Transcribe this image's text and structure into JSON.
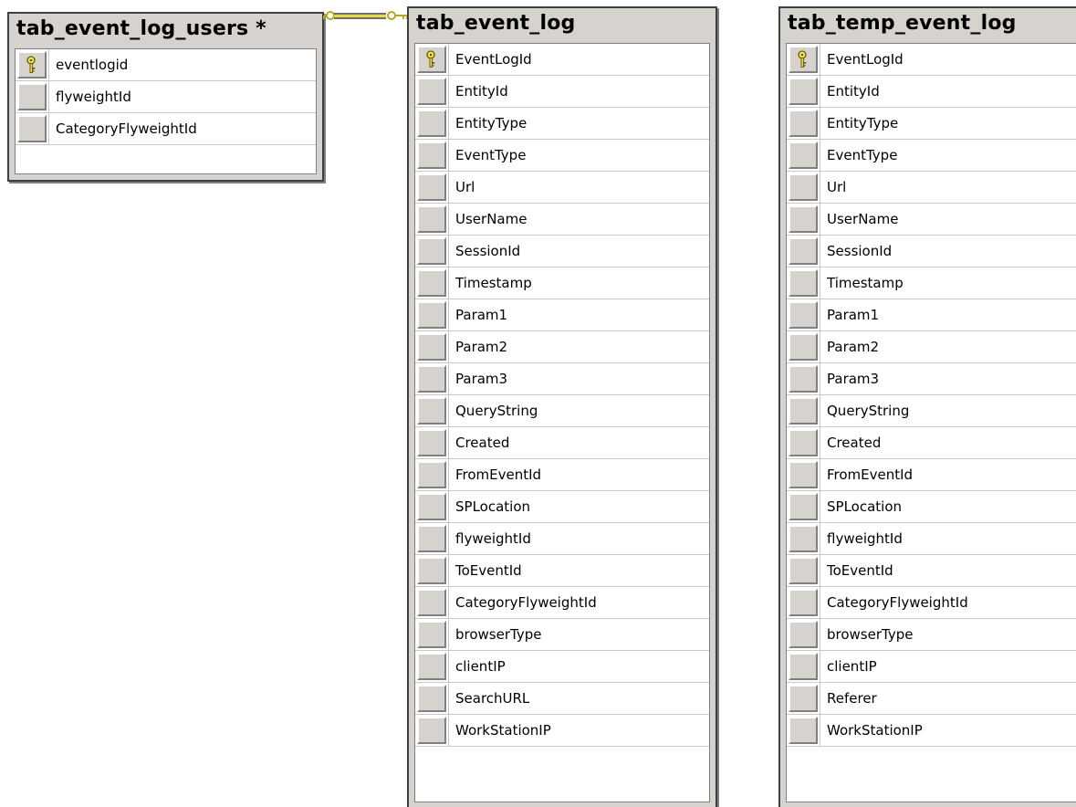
{
  "tables": [
    {
      "title": "tab_event_log_users *",
      "columns": [
        {
          "name": "eventlogid",
          "primary_key": true
        },
        {
          "name": "flyweightId",
          "primary_key": false
        },
        {
          "name": "CategoryFlyweightId",
          "primary_key": false
        }
      ]
    },
    {
      "title": "tab_event_log",
      "columns": [
        {
          "name": "EventLogId",
          "primary_key": true
        },
        {
          "name": "EntityId",
          "primary_key": false
        },
        {
          "name": "EntityType",
          "primary_key": false
        },
        {
          "name": "EventType",
          "primary_key": false
        },
        {
          "name": "Url",
          "primary_key": false
        },
        {
          "name": "UserName",
          "primary_key": false
        },
        {
          "name": "SessionId",
          "primary_key": false
        },
        {
          "name": "Timestamp",
          "primary_key": false
        },
        {
          "name": "Param1",
          "primary_key": false
        },
        {
          "name": "Param2",
          "primary_key": false
        },
        {
          "name": "Param3",
          "primary_key": false
        },
        {
          "name": "QueryString",
          "primary_key": false
        },
        {
          "name": "Created",
          "primary_key": false
        },
        {
          "name": "FromEventId",
          "primary_key": false
        },
        {
          "name": "SPLocation",
          "primary_key": false
        },
        {
          "name": "flyweightId",
          "primary_key": false
        },
        {
          "name": "ToEventId",
          "primary_key": false
        },
        {
          "name": "CategoryFlyweightId",
          "primary_key": false
        },
        {
          "name": "browserType",
          "primary_key": false
        },
        {
          "name": "clientIP",
          "primary_key": false
        },
        {
          "name": "SearchURL",
          "primary_key": false
        },
        {
          "name": "WorkStationIP",
          "primary_key": false
        }
      ]
    },
    {
      "title": "tab_temp_event_log",
      "columns": [
        {
          "name": "EventLogId",
          "primary_key": true
        },
        {
          "name": "EntityId",
          "primary_key": false
        },
        {
          "name": "EntityType",
          "primary_key": false
        },
        {
          "name": "EventType",
          "primary_key": false
        },
        {
          "name": "Url",
          "primary_key": false
        },
        {
          "name": "UserName",
          "primary_key": false
        },
        {
          "name": "SessionId",
          "primary_key": false
        },
        {
          "name": "Timestamp",
          "primary_key": false
        },
        {
          "name": "Param1",
          "primary_key": false
        },
        {
          "name": "Param2",
          "primary_key": false
        },
        {
          "name": "Param3",
          "primary_key": false
        },
        {
          "name": "QueryString",
          "primary_key": false
        },
        {
          "name": "Created",
          "primary_key": false
        },
        {
          "name": "FromEventId",
          "primary_key": false
        },
        {
          "name": "SPLocation",
          "primary_key": false
        },
        {
          "name": "flyweightId",
          "primary_key": false
        },
        {
          "name": "ToEventId",
          "primary_key": false
        },
        {
          "name": "CategoryFlyweightId",
          "primary_key": false
        },
        {
          "name": "browserType",
          "primary_key": false
        },
        {
          "name": "clientIP",
          "primary_key": false
        },
        {
          "name": "Referer",
          "primary_key": false
        },
        {
          "name": "WorkStationIP",
          "primary_key": false
        }
      ]
    }
  ],
  "relationships": [
    {
      "from": "tab_event_log_users *",
      "to": "tab_event_log",
      "type": "one-to-one",
      "icon": "key-connector-icon"
    }
  ],
  "colors": {
    "table_background": "#d6d3ce",
    "grid_background": "#ffffff",
    "key_icon": "#e8d84a",
    "relationship_line": "#d4c43a"
  }
}
